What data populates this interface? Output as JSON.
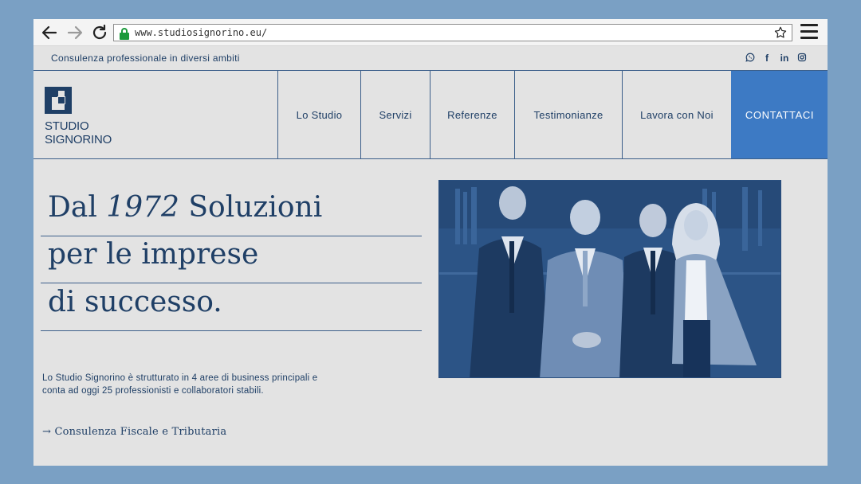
{
  "browser": {
    "url": "www.studiosignorino.eu/"
  },
  "topbar": {
    "tagline": "Consulenza professionale in diversi ambiti",
    "socials": [
      {
        "name": "whatsapp-icon"
      },
      {
        "name": "facebook-icon",
        "glyph": "f"
      },
      {
        "name": "linkedin-icon",
        "glyph": "in"
      },
      {
        "name": "instagram-icon"
      }
    ]
  },
  "logo": {
    "line1": "STUDIO",
    "line2": "SIGNORINO"
  },
  "nav": {
    "items": [
      {
        "label": "Lo Studio"
      },
      {
        "label": "Servizi"
      },
      {
        "label": "Referenze"
      },
      {
        "label": "Testimonianze"
      },
      {
        "label": "Lavora con Noi"
      }
    ],
    "cta": "CONTATTACI"
  },
  "hero": {
    "line1_pre": "Dal ",
    "line1_year": "1972",
    "line1_post": " Soluzioni",
    "line2": "per le imprese",
    "line3": "di successo.",
    "description": "Lo Studio Signorino è strutturato in 4 aree di business principali e conta ad oggi 25 professionisti e collaboratori stabili.",
    "link_arrow": "→",
    "link_label": "Consulenza Fiscale e Tributaria"
  },
  "colors": {
    "brand_blue": "#1f3f66",
    "cta_blue": "#3d7ac4",
    "page_bg": "#e3e3e3",
    "frame_bg": "#7aa0c4"
  }
}
